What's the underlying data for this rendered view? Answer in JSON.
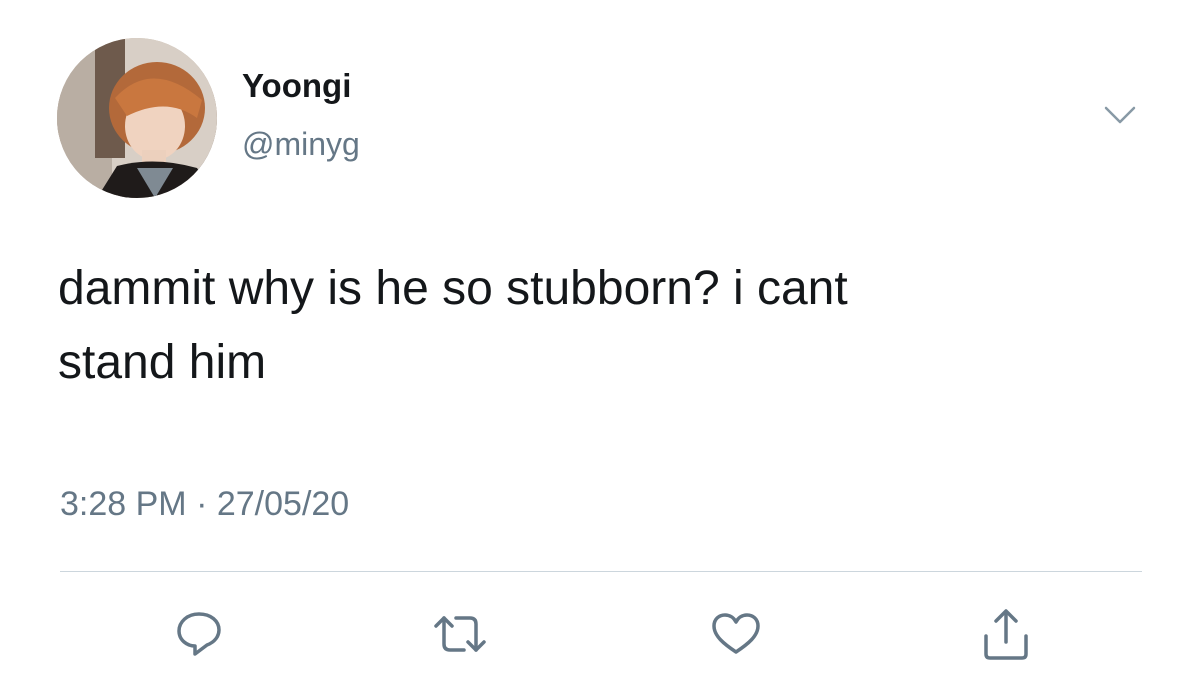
{
  "tweet": {
    "display_name": "Yoongi",
    "handle": "@minyg",
    "text_line1": "dammit why is he so stubborn? i cant",
    "text_line2": "stand him",
    "time": "3:28 PM",
    "separator": "·",
    "date": "27/05/20"
  },
  "icons": {
    "more": "chevron-down-icon",
    "reply": "reply-icon",
    "retweet": "retweet-icon",
    "like": "heart-icon",
    "share": "share-icon"
  },
  "colors": {
    "primary_text": "#14171a",
    "secondary_text": "#657786",
    "divider": "#ccd6dd",
    "icon": "#657786"
  }
}
